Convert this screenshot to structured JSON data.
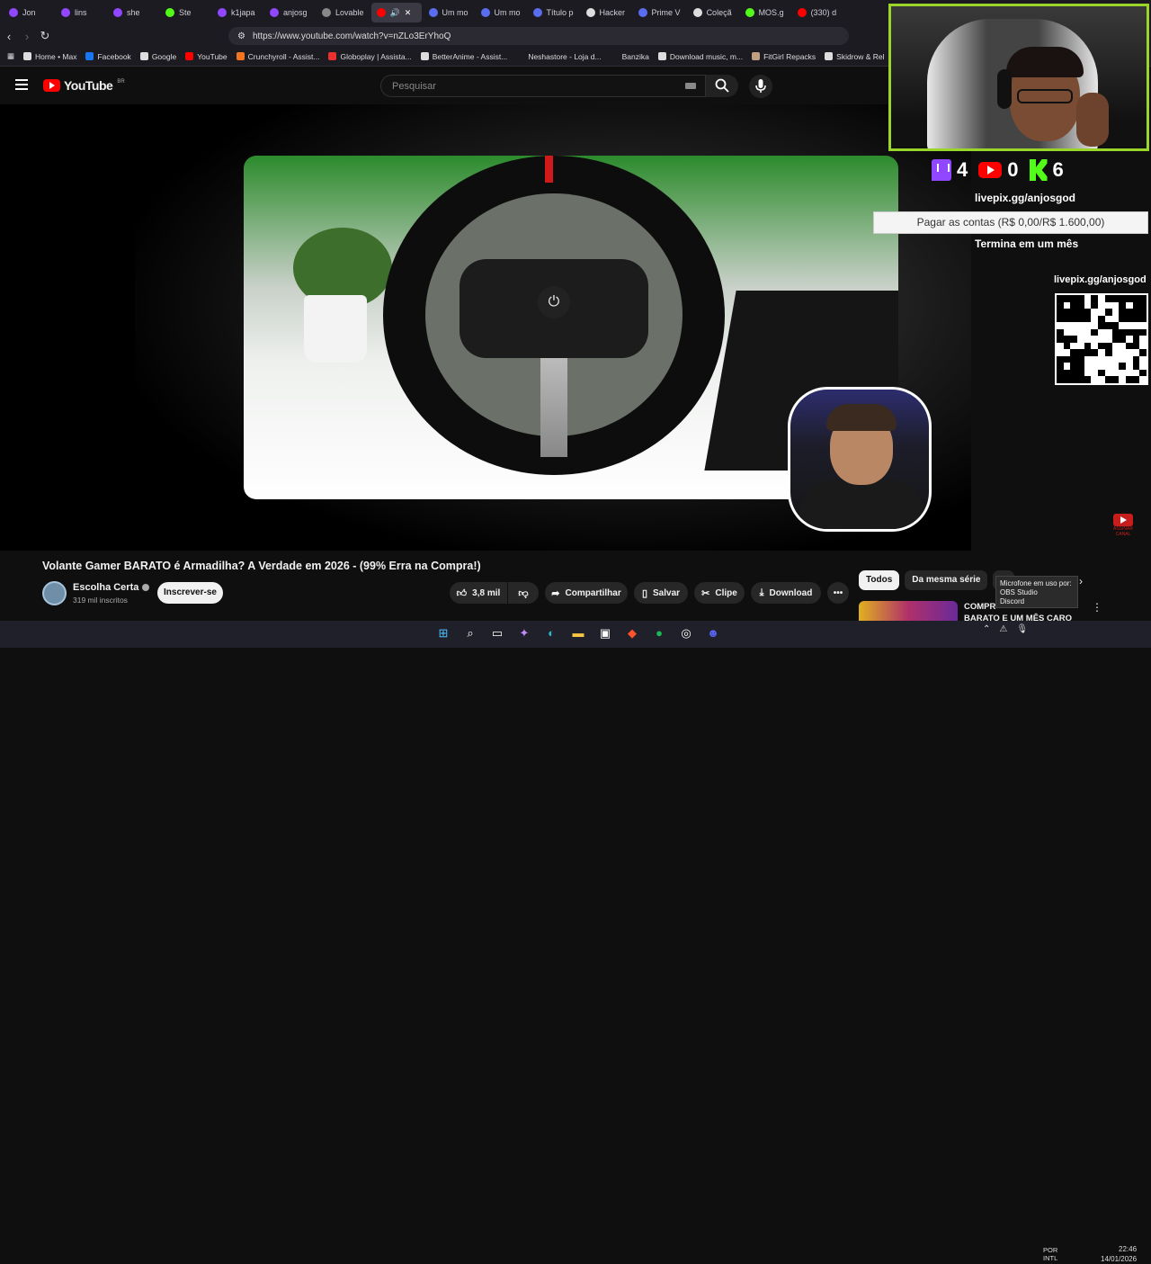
{
  "browser": {
    "tabs": [
      {
        "label": "Jon",
        "color": "#9146ff"
      },
      {
        "label": "lins",
        "color": "#9146ff"
      },
      {
        "label": "she",
        "color": "#9146ff"
      },
      {
        "label": "Ste",
        "color": "#53fc18"
      },
      {
        "label": "k1japa",
        "color": "#9146ff"
      },
      {
        "label": "anjosg",
        "color": "#9146ff"
      },
      {
        "label": "Lovable",
        "color": "#888888"
      },
      {
        "label": "",
        "color": "#ff0000"
      },
      {
        "label": "Um mo",
        "color": "#5a6cf0"
      },
      {
        "label": "Um mo",
        "color": "#5a6cf0"
      },
      {
        "label": "Título p",
        "color": "#5a6cf0"
      },
      {
        "label": "Hacker",
        "color": "#dddddd"
      },
      {
        "label": "Prime V",
        "color": "#5a6cf0"
      },
      {
        "label": "Coleçã",
        "color": "#dddddd"
      },
      {
        "label": "MOS.g",
        "color": "#53fc18"
      },
      {
        "label": "(330) d",
        "color": "#ff0000"
      }
    ],
    "url": "https://www.youtube.com/watch?v=nZLo3ErYhoQ",
    "bookmarks": [
      {
        "label": "Home • Max",
        "color": "#dddddd"
      },
      {
        "label": "Facebook",
        "color": "#1877f2"
      },
      {
        "label": "Google",
        "color": "#dddddd"
      },
      {
        "label": "YouTube",
        "color": "#ff0000"
      },
      {
        "label": "Crunchyroll - Assist...",
        "color": "#f47521"
      },
      {
        "label": "Globoplay | Assista...",
        "color": "#e8312f"
      },
      {
        "label": "BetterAnime - Assist...",
        "color": "#dddddd"
      },
      {
        "label": "Neshastore - Loja d...",
        "color": "#1c1b22"
      },
      {
        "label": "Banzika",
        "color": "#1c1b22"
      },
      {
        "label": "Download music, m...",
        "color": "#dddddd"
      },
      {
        "label": "FitGirl Repacks",
        "color": "#c0a080"
      },
      {
        "label": "Skidrow & Rel",
        "color": "#dddddd"
      }
    ]
  },
  "youtube": {
    "logo_text": "YouTube",
    "country": "BR",
    "search_placeholder": "Pesquisar",
    "video_title": "Volante Gamer BARATO é Armadilha? A Verdade em 2026 - (99% Erra na Compra!)",
    "channel": {
      "name": "Escolha Certa",
      "subscribers": "319 mil inscritos"
    },
    "subscribe_label": "Inscrever-se",
    "actions": {
      "likes": "3,8 mil",
      "share": "Compartilhar",
      "save": "Salvar",
      "clip": "Clipe",
      "download": "Download"
    },
    "chips": [
      "Todos",
      "Da mesma série",
      "D"
    ],
    "recommendation_title_1": "COMPR",
    "recommendation_title_2": "BARATO E UM MÊS CARO"
  },
  "overlay": {
    "stats": {
      "twitch": "4",
      "youtube": "0",
      "kick": "6"
    },
    "livepix": "livepix.gg/anjosgod",
    "goal": "Pagar as contas (R$ 0,00/R$ 1.600,00)",
    "goal_sub": "Termina em um mês",
    "qr_label": "livepix.gg/anjosgod",
    "subscribe_badge": "ASSINAR CANAL"
  },
  "mic_tooltip": {
    "title": "Microfone em uso por:",
    "apps": [
      "OBS Studio",
      "Discord"
    ]
  },
  "taskbar": {
    "lang_1": "POR",
    "lang_2": "INTL",
    "time": "22:46",
    "date": "14/01/2026"
  }
}
